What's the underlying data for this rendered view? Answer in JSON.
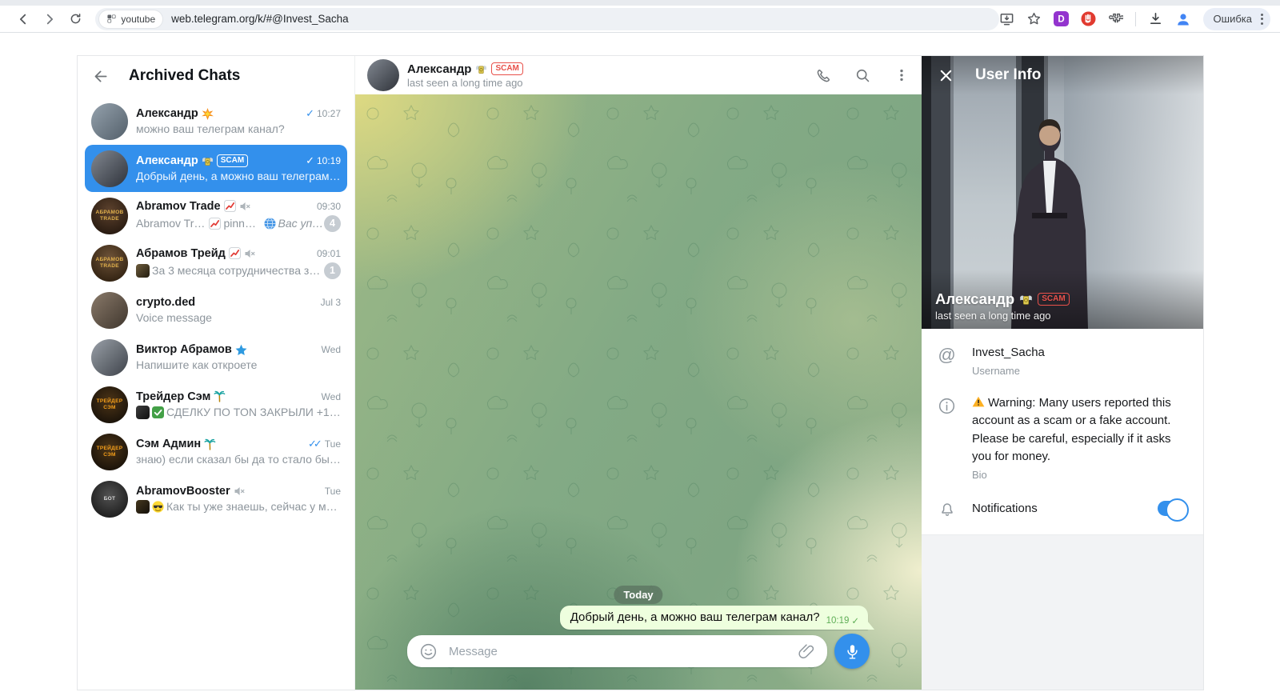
{
  "browser": {
    "tab_chip": "youtube",
    "url": "web.telegram.org/k/#@Invest_Sacha",
    "profile_label": "Ошибка"
  },
  "sidebar": {
    "title": "Archived Chats",
    "chats": [
      {
        "name": "Александр",
        "name_emojis": [
          "collision"
        ],
        "time": "10:27",
        "checks": 1,
        "preview": [
          {
            "t": "text",
            "v": "можно ваш телеграм канал?"
          }
        ],
        "avatar": {
          "style": "car"
        }
      },
      {
        "name": "Александр",
        "name_emojis": [
          "money-wings"
        ],
        "scam": "SCAM",
        "selected": true,
        "time": "10:19",
        "checks": 1,
        "preview": [
          {
            "t": "text",
            "v": "Добрый день, а можно ваш телеграм ка..."
          }
        ],
        "avatar": {
          "style": "suit"
        }
      },
      {
        "name": "Abramov Trade",
        "name_emojis": [
          "chart-up"
        ],
        "muted": true,
        "time": "09:30",
        "badge": "4",
        "preview": [
          {
            "t": "text",
            "v": "Abramov Trade "
          },
          {
            "t": "emoji",
            "v": "chart-up"
          },
          {
            "t": "text",
            "v": " pinned \""
          },
          {
            "t": "emoji",
            "v": "globe"
          },
          {
            "t": "italic",
            "v": " Вас упо..."
          }
        ],
        "avatar": {
          "style": "abramov",
          "label": "АБРАМОВ TRADE"
        }
      },
      {
        "name": "Абрамов Трейд",
        "name_emojis": [
          "chart-up"
        ],
        "muted": true,
        "time": "09:01",
        "badge": "1",
        "preview": [
          {
            "t": "thumb",
            "v": "video1"
          },
          {
            "t": "text",
            "v": "За 3 месяца сотрудничества зар..."
          }
        ],
        "avatar": {
          "style": "abramov2",
          "label": "АБРАМОВ TRADE"
        }
      },
      {
        "name": "crypto.ded",
        "time": "Jul 3",
        "preview": [
          {
            "t": "text",
            "v": "Voice message"
          }
        ],
        "avatar": {
          "style": "kid"
        }
      },
      {
        "name": "Виктор Абрамов",
        "name_emojis": [
          "blue-star"
        ],
        "time": "Wed",
        "preview": [
          {
            "t": "text",
            "v": "Напишите как откроете"
          }
        ],
        "avatar": {
          "style": "viktor"
        }
      },
      {
        "name": "Трейдер Сэм",
        "name_emojis": [
          "palm"
        ],
        "time": "Wed",
        "preview": [
          {
            "t": "thumb",
            "v": "video2"
          },
          {
            "t": "emoji",
            "v": "check-green"
          },
          {
            "t": "text",
            "v": "СДЕЛКУ ПО TON ЗАКРЫЛИ +176%..."
          }
        ],
        "avatar": {
          "style": "sam",
          "label": "ТРЕЙДЕР СЭМ"
        }
      },
      {
        "name": "Сэм Админ",
        "name_emojis": [
          "palm"
        ],
        "time": "Tue",
        "checks": 2,
        "preview": [
          {
            "t": "text",
            "v": "знаю) если сказал бы да то стало бы вс..."
          }
        ],
        "avatar": {
          "style": "sam",
          "label": "ТРЕЙДЕР СЭМ"
        }
      },
      {
        "name": "AbramovBooster",
        "muted": true,
        "time": "Tue",
        "preview": [
          {
            "t": "thumb",
            "v": "video3"
          },
          {
            "t": "emoji",
            "v": "sunglasses"
          },
          {
            "t": "text",
            "v": "Как ты уже знаешь, сейчас у меня ..."
          }
        ],
        "avatar": {
          "style": "bot",
          "label": "БОТ"
        }
      }
    ]
  },
  "chat": {
    "header": {
      "name": "Александр",
      "name_emoji": "money-wings",
      "scam": "SCAM",
      "status": "last seen a long time ago"
    },
    "date_pill": "Today",
    "message": {
      "text": "Добрый день, а можно ваш телеграм канал?",
      "time": "10:19"
    },
    "input_placeholder": "Message"
  },
  "userinfo": {
    "title": "User Info",
    "name": "Александр",
    "name_emoji": "money-wings",
    "scam": "SCAM",
    "status": "last seen a long time ago",
    "username": {
      "value": "Invest_Sacha",
      "label": "Username"
    },
    "bio": {
      "text": "Warning: Many users reported this account as a scam or a fake account. Please be careful, especially if it asks you for money.",
      "label": "Bio"
    },
    "notifications": {
      "label": "Notifications",
      "on": true
    }
  },
  "colors": {
    "accent": "#3390ec",
    "scam_red": "#e8514a",
    "bubble_green": "#eeffde"
  }
}
